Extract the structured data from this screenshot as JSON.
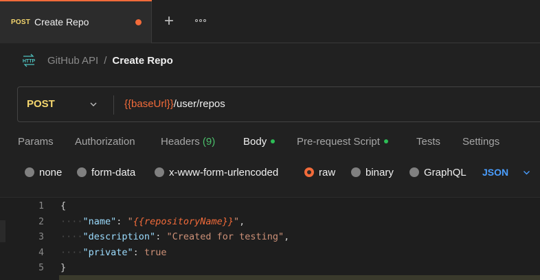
{
  "tab": {
    "method": "POST",
    "title": "Create Repo",
    "new_tab_icon": "plus-icon",
    "more_icon": "ellipsis-icon"
  },
  "breadcrumb": {
    "icon": "http-icon",
    "icon_text": "HTTP",
    "collection": "GitHub API",
    "separator": "/",
    "current": "Create Repo"
  },
  "request": {
    "method": "POST",
    "url_variable": "{{baseUrl}}",
    "url_path": "/user/repos"
  },
  "request_tabs": {
    "params": "Params",
    "authorization": "Authorization",
    "headers": "Headers",
    "headers_count": "(9)",
    "body": "Body",
    "prerequest": "Pre-request Script",
    "tests": "Tests",
    "settings": "Settings"
  },
  "body_types": {
    "none": "none",
    "form_data": "form-data",
    "urlencoded": "x-www-form-urlencoded",
    "raw": "raw",
    "binary": "binary",
    "graphql": "GraphQL",
    "selected": "raw",
    "format": "JSON"
  },
  "editor": {
    "line_numbers": [
      "1",
      "2",
      "3",
      "4",
      "5"
    ],
    "open_brace": "{",
    "close_brace": "}",
    "indent": "····",
    "lines": [
      {
        "key": "\"name\"",
        "sep": ": ",
        "value_quote_open": "\"",
        "value_var": "{{repositoryName}}",
        "value_quote_close": "\"",
        "trail": ","
      },
      {
        "key": "\"description\"",
        "sep": ": ",
        "value": "\"Created for testing\"",
        "trail": ","
      },
      {
        "key": "\"private\"",
        "sep": ": ",
        "value": "true",
        "trail": ""
      }
    ]
  },
  "colors": {
    "accent": "#f26b3a",
    "method": "#f5d76e",
    "json": "#4a9eff",
    "active_dot": "#2dbd56"
  }
}
